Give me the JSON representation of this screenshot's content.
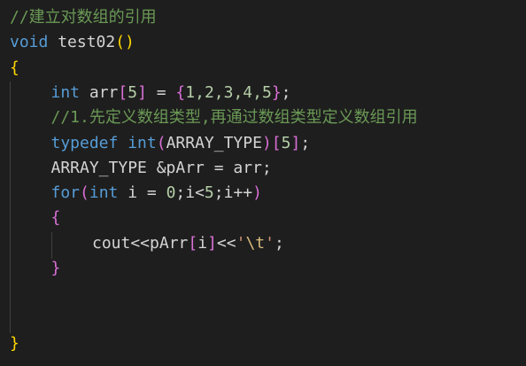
{
  "editor": {
    "lines": [
      {
        "indent": 0,
        "tokens": [
          {
            "text": "//建立对数组的引用",
            "kind": "comment"
          }
        ]
      },
      {
        "indent": 0,
        "tokens": [
          {
            "text": "void",
            "kind": "keyword"
          },
          {
            "text": " test02",
            "kind": "default"
          },
          {
            "text": "()",
            "kind": "paren1"
          }
        ]
      },
      {
        "indent": 0,
        "tokens": [
          {
            "text": "{",
            "kind": "paren1"
          }
        ]
      },
      {
        "indent": 1,
        "tokens": [
          {
            "text": "int",
            "kind": "keyword"
          },
          {
            "text": " arr",
            "kind": "default"
          },
          {
            "text": "[",
            "kind": "paren2"
          },
          {
            "text": "5",
            "kind": "number"
          },
          {
            "text": "]",
            "kind": "paren2"
          },
          {
            "text": " = ",
            "kind": "default"
          },
          {
            "text": "{",
            "kind": "paren2"
          },
          {
            "text": "1,2,3,4,5",
            "kind": "number"
          },
          {
            "text": "}",
            "kind": "paren2"
          },
          {
            "text": ";",
            "kind": "default"
          }
        ]
      },
      {
        "indent": 1,
        "tokens": [
          {
            "text": "//1.先定义数组类型,再通过数组类型定义数组引用",
            "kind": "comment"
          }
        ]
      },
      {
        "indent": 1,
        "tokens": [
          {
            "text": "typedef",
            "kind": "keyword"
          },
          {
            "text": " int",
            "kind": "keyword"
          },
          {
            "text": "(",
            "kind": "paren2"
          },
          {
            "text": "ARRAY_TYPE",
            "kind": "default"
          },
          {
            "text": ")",
            "kind": "paren2"
          },
          {
            "text": "[",
            "kind": "paren2"
          },
          {
            "text": "5",
            "kind": "number"
          },
          {
            "text": "]",
            "kind": "paren2"
          },
          {
            "text": ";",
            "kind": "default"
          }
        ]
      },
      {
        "indent": 1,
        "tokens": [
          {
            "text": "ARRAY_TYPE &pArr = arr;",
            "kind": "default"
          }
        ]
      },
      {
        "indent": 1,
        "tokens": [
          {
            "text": "for",
            "kind": "keyword"
          },
          {
            "text": "(",
            "kind": "paren2"
          },
          {
            "text": "int",
            "kind": "keyword"
          },
          {
            "text": " i = ",
            "kind": "default"
          },
          {
            "text": "0",
            "kind": "number"
          },
          {
            "text": ";i<",
            "kind": "default"
          },
          {
            "text": "5",
            "kind": "number"
          },
          {
            "text": ";i++",
            "kind": "default"
          },
          {
            "text": ")",
            "kind": "paren2"
          }
        ]
      },
      {
        "indent": 1,
        "tokens": [
          {
            "text": "{",
            "kind": "paren2"
          }
        ]
      },
      {
        "indent": 2,
        "tokens": [
          {
            "text": "cout<<pArr",
            "kind": "default"
          },
          {
            "text": "[",
            "kind": "paren2"
          },
          {
            "text": "i",
            "kind": "default"
          },
          {
            "text": "]",
            "kind": "paren2"
          },
          {
            "text": "<<",
            "kind": "default"
          },
          {
            "text": "'",
            "kind": "string"
          },
          {
            "text": "\\t",
            "kind": "escape"
          },
          {
            "text": "'",
            "kind": "string"
          },
          {
            "text": ";",
            "kind": "default"
          }
        ]
      },
      {
        "indent": 1,
        "tokens": [
          {
            "text": "}",
            "kind": "paren2"
          }
        ]
      },
      {
        "indent": 0,
        "tokens": []
      },
      {
        "indent": 0,
        "tokens": []
      },
      {
        "indent": 0,
        "tokens": [
          {
            "text": "}",
            "kind": "paren1"
          }
        ]
      }
    ]
  }
}
